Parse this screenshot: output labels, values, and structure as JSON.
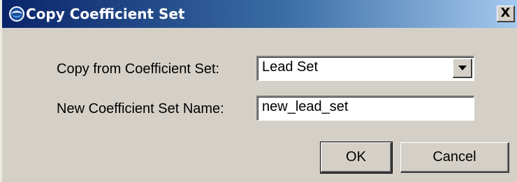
{
  "window": {
    "title": "Copy Coefficient Set",
    "title_icon": "noaa-logo-icon",
    "close_label": "X"
  },
  "form": {
    "copy_from_label": "Copy from Coefficient Set:",
    "copy_from_value": "Lead Set",
    "new_name_label": "New Coefficient Set Name:",
    "new_name_value": "new_lead_set"
  },
  "buttons": {
    "ok_label": "OK",
    "cancel_label": "Cancel"
  },
  "colors": {
    "title_bar_start": "#0a246a",
    "title_bar_end": "#a6caf0",
    "window_background": "#d4d0c8"
  }
}
